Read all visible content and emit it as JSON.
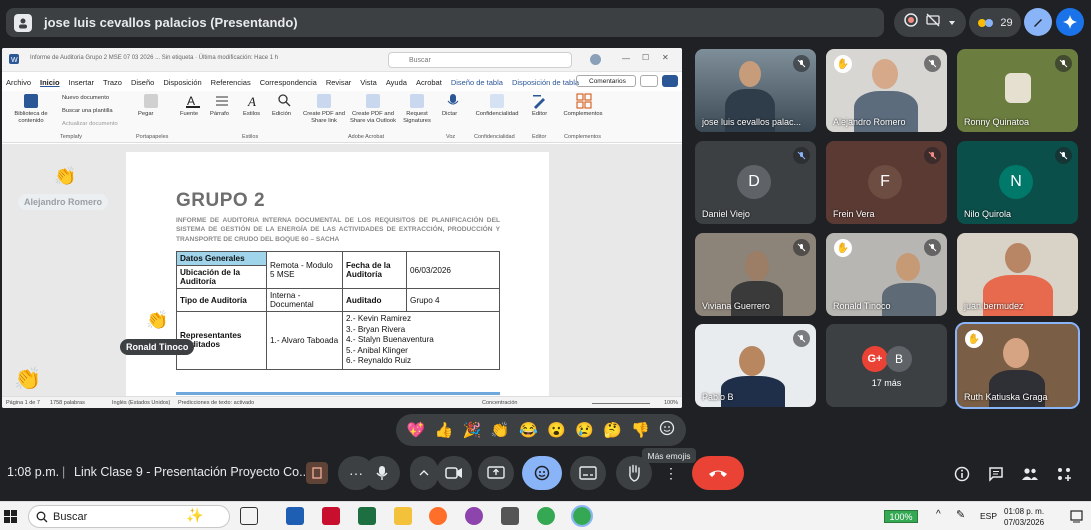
{
  "meet": {
    "presenter_label": "jose luis cevallos palacios (Presentando)",
    "participants_count": "29",
    "clock": "1:08 p.m.",
    "title": "Link Clase 9 - Presentación Proyecto Co...",
    "tooltip": "Más emojis",
    "reactions": [
      "💖",
      "👍",
      "🎉",
      "👏",
      "😂",
      "😮",
      "😢",
      "🤔",
      "👎"
    ],
    "colors": {
      "bg": "#202124",
      "pill": "#3c4043",
      "accent": "#8ab4f8",
      "end_call": "#ea4335"
    }
  },
  "word": {
    "window_title": "Informe de Auditoria Grupo 2 MSE 07 03 2026 ...  Sin etiqueta · Última modificación: Hace 1 h",
    "search_placeholder": "Buscar",
    "menu": [
      "Archivo",
      "Inicio",
      "Insertar",
      "Trazo",
      "Diseño",
      "Disposición",
      "Referencias",
      "Correspondencia",
      "Revisar",
      "Vista",
      "Ayuda",
      "Acrobat",
      "Diseño de tabla",
      "Disposición de tabla"
    ],
    "comments_label": "Comentarios",
    "ribbon": {
      "biblioteca": "Biblioteca de contenido",
      "nuevo_documento": "Nuevo documento",
      "buscar_plantilla": "Buscar una plantilla",
      "actualizar_documento": "Actualizar documento",
      "templafy": "Templafy",
      "pegar": "Pegar",
      "portapapeles": "Portapapeles",
      "fuente": "Fuente",
      "parrafo": "Párrafo",
      "estilos": "Estilos",
      "estilos_group": "Estilos",
      "edicion": "Edición",
      "create_pdf_link": "Create PDF and Share link",
      "create_pdf_outlook": "Create PDF and Share via Outlook",
      "request_signatures": "Request Signatures",
      "adobe_acrobat": "Adobe Acrobat",
      "dictar": "Dictar",
      "voz": "Voz",
      "confidencialidad": "Confidencialidad",
      "confidencialidad_group": "Confidencialidad",
      "editor": "Editor",
      "editor_group": "Editor",
      "complementos": "Complementos",
      "complementos_group": "Complementos"
    },
    "document": {
      "heading": "GRUPO 2",
      "subtitle": "INFORME DE AUDITORIA INTERNA DOCUMENTAL DE LOS REQUISITOS DE PLANIFICACIÓN DEL SISTEMA DE GESTIÓN DE LA ENERGÍA DE LAS ACTIVIDADES DE EXTRACCIÓN, PRODUCCIÓN Y TRANSPORTE DE CRUDO DEL BOQUE 60 – SACHA",
      "table": {
        "datos_generales": "Datos Generales",
        "ubicacion_label": "Ubicación de la Auditoría",
        "ubicacion_value": "Remota - Modulo 5 MSE",
        "fecha_label": "Fecha de la Auditoría",
        "fecha_value": "06/03/2026",
        "tipo_label": "Tipo de Auditoría",
        "tipo_value": "Interna - Documental",
        "auditado_label": "Auditado",
        "auditado_value": "Grupo 4",
        "representantes_label": "Representantes Auditados",
        "representantes_value": "1.- Alvaro Taboada",
        "auditados": [
          "2.- Kevin Ramirez",
          "3.- Bryan Rivera",
          "4.- Stalyn Buenaventura",
          "5.- Anibal Klinger",
          "6.- Reynaldo Ruiz"
        ]
      }
    },
    "status": {
      "page": "Página 1 de 7",
      "words": "1758 palabras",
      "language": "Inglés (Estados Unidos)",
      "predictions": "Predicciones de texto: activado",
      "focus": "Concentración",
      "zoom": "100%"
    }
  },
  "floating_names": {
    "alejandro": "Alejandro Romero",
    "ronald": "Ronald Tinoco"
  },
  "tiles": [
    {
      "name": "jose luis cevallos palac...",
      "type": "video"
    },
    {
      "name": "Alejandro Romero",
      "type": "video"
    },
    {
      "name": "Ronny Quinatoa",
      "type": "video"
    },
    {
      "name": "Daniel Viejo",
      "letter": "D",
      "color": "#5f6368"
    },
    {
      "name": "Frein Vera",
      "letter": "F",
      "color": "#5f6368"
    },
    {
      "name": "Nilo Quirola",
      "letter": "N",
      "color": "#00796b"
    },
    {
      "name": "Viviana Guerrero",
      "type": "video"
    },
    {
      "name": "Ronald Tinoco",
      "type": "video"
    },
    {
      "name": "juan bermudez",
      "type": "video"
    },
    {
      "name": "Pablo B",
      "type": "video"
    },
    {
      "name": "17 más",
      "type": "more"
    },
    {
      "name": "Ruth Katiuska Graga",
      "type": "video"
    }
  ],
  "taskbar": {
    "search": "Buscar",
    "battery": "100%",
    "lang": "ESP",
    "time": "01:08 p. m.",
    "date": "07/03/2026"
  }
}
